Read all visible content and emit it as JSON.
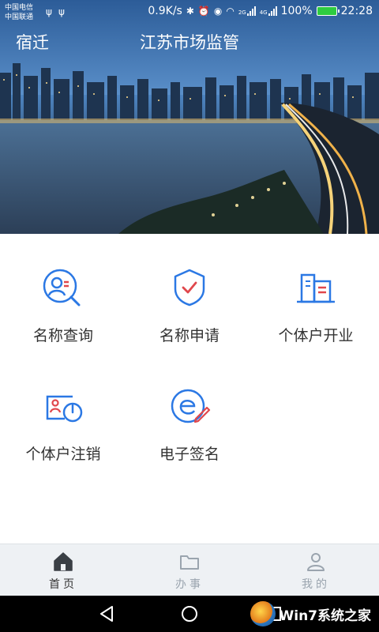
{
  "status_bar": {
    "carrier1": "中国电信",
    "carrier2": "中国联通",
    "usb_icon": "usb-icon",
    "net_speed": "0.9K/s",
    "network_labels": [
      "2G",
      "4G"
    ],
    "battery_percent": "100%",
    "battery_level": 1.0,
    "time": "22:28"
  },
  "header": {
    "city": "宿迁",
    "title": "江苏市场监管"
  },
  "services": [
    {
      "label": "名称查询",
      "icon": "name-search-icon"
    },
    {
      "label": "名称申请",
      "icon": "shield-check-icon"
    },
    {
      "label": "个体户开业",
      "icon": "building-icon"
    },
    {
      "label": "个体户注销",
      "icon": "cancel-business-icon"
    },
    {
      "label": "电子签名",
      "icon": "e-signature-icon"
    }
  ],
  "tabs": [
    {
      "label": "首页",
      "icon": "home-icon",
      "active": true
    },
    {
      "label": "办事",
      "icon": "folder-icon",
      "active": false
    },
    {
      "label": "我的",
      "icon": "user-icon",
      "active": false
    }
  ],
  "nav": {
    "back_icon": "back-triangle-icon",
    "home_icon": "home-circle-icon",
    "recent_icon": "recent-square-icon"
  },
  "watermark": {
    "text": "Win7系统之家"
  },
  "colors": {
    "accent": "#2b78e4",
    "accent_red": "#e0474c",
    "tab_active": "#3a3f45",
    "tab_inactive": "#9aa4ae"
  }
}
